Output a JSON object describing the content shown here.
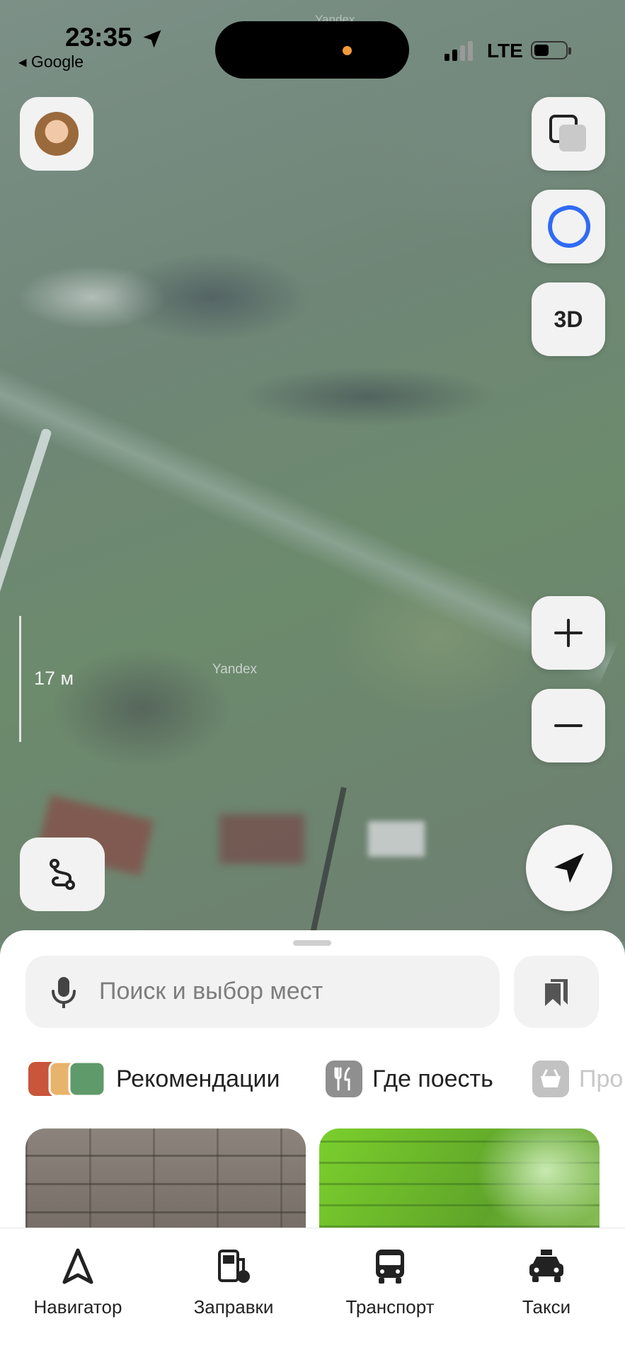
{
  "status_bar": {
    "time": "23:35",
    "back_app": "◂ Google",
    "network": "LTE"
  },
  "map": {
    "watermark": "Yandex",
    "scale_label": "17 м",
    "buttons": {
      "layers_icon": "layers-icon",
      "alice_icon": "alice-icon",
      "mode_3d": "3D",
      "zoom_in": "+",
      "zoom_out": "−"
    }
  },
  "search": {
    "placeholder": "Поиск и выбор мест"
  },
  "categories": [
    {
      "label": "Рекомендации"
    },
    {
      "label": "Где поесть"
    },
    {
      "label": "Про"
    }
  ],
  "tabs": [
    {
      "label": "Навигатор",
      "icon": "navigator-icon"
    },
    {
      "label": "Заправки",
      "icon": "fuel-icon"
    },
    {
      "label": "Транспорт",
      "icon": "bus-icon"
    },
    {
      "label": "Такси",
      "icon": "taxi-icon"
    }
  ],
  "colors": {
    "accent_blue": "#2f6bf5",
    "island_dot": "#f39a3a"
  }
}
